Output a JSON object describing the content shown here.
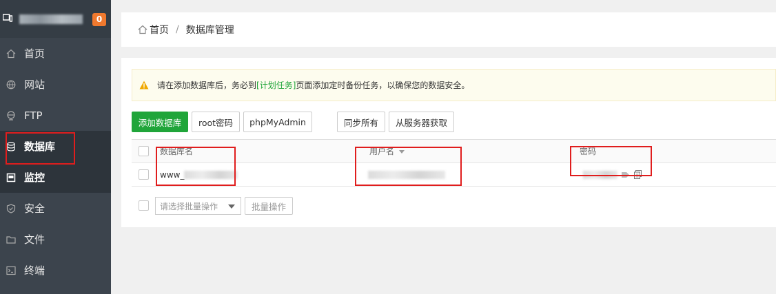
{
  "sidebar": {
    "host_label": "4  ...",
    "badge": "0",
    "items": [
      {
        "label": "首页",
        "icon": "home-icon"
      },
      {
        "label": "网站",
        "icon": "globe-icon"
      },
      {
        "label": "FTP",
        "icon": "ftp-icon"
      },
      {
        "label": "数据库",
        "icon": "database-icon"
      },
      {
        "label": "监控",
        "icon": "monitor-icon"
      },
      {
        "label": "安全",
        "icon": "shield-icon"
      },
      {
        "label": "文件",
        "icon": "folder-icon"
      },
      {
        "label": "终端",
        "icon": "terminal-icon"
      }
    ]
  },
  "breadcrumb": {
    "home": "首页",
    "separator": "/",
    "current": "数据库管理"
  },
  "notice": {
    "before": "请在添加数据库后，务必到",
    "link": "[计划任务]",
    "after": "页面添加定时备份任务，以确保您的数据安全。"
  },
  "toolbar": {
    "add_db": "添加数据库",
    "root_pwd": "root密码",
    "phpmyadmin": "phpMyAdmin",
    "sync_all": "同步所有",
    "fetch_server": "从服务器获取"
  },
  "table": {
    "headers": {
      "name": "数据库名",
      "user": "用户名",
      "password": "密码"
    },
    "rows": [
      {
        "name_prefix": "www_"
      }
    ]
  },
  "batch": {
    "select_placeholder": "请选择批量操作",
    "button": "批量操作"
  },
  "colors": {
    "accent": "#20a53a",
    "sidebar": "#3c444d",
    "highlight": "#e01d1d",
    "badge": "#f0792e"
  }
}
